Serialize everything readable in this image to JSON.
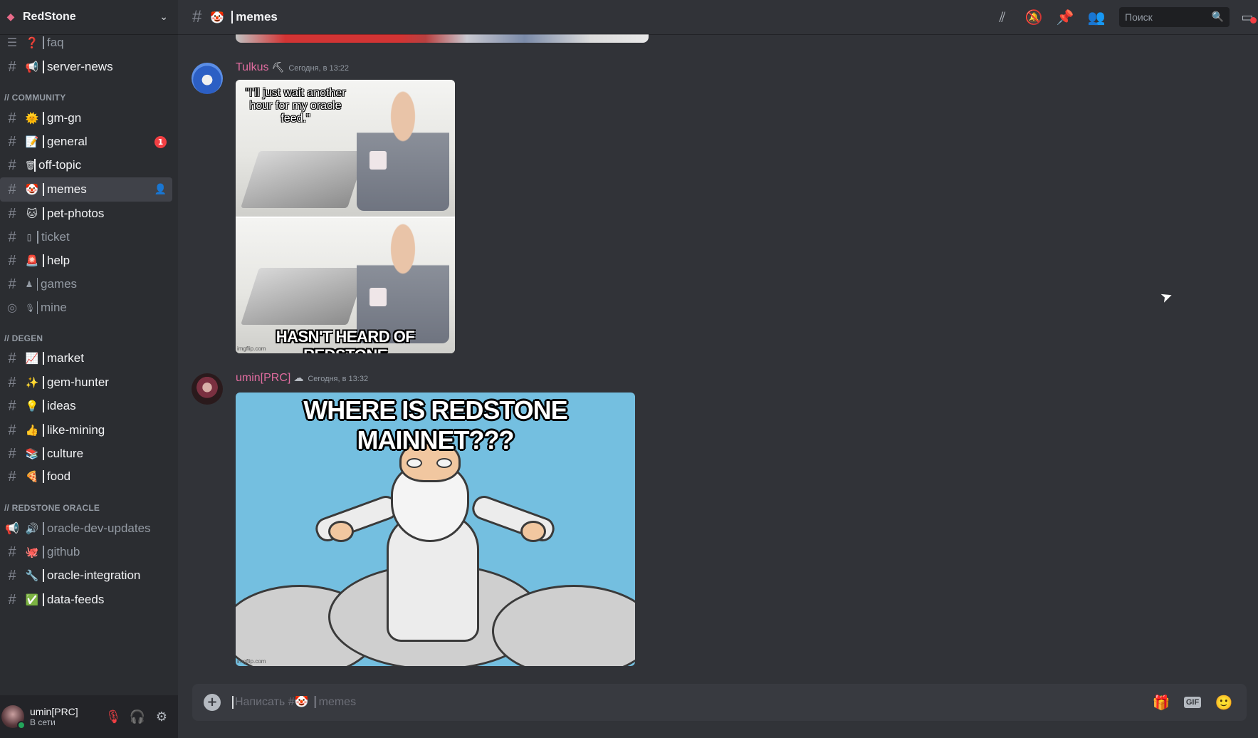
{
  "server": {
    "name": "RedStone",
    "icon": "redstone-logo-icon"
  },
  "sidebar": {
    "top_channels": [
      {
        "emoji": "❓",
        "name": "faq",
        "type": "forum",
        "state": "dim"
      },
      {
        "emoji": "📢",
        "name": "server-news",
        "type": "text",
        "state": "bright"
      }
    ],
    "categories": [
      {
        "label": "// COMMUNITY",
        "channels": [
          {
            "emoji": "🌞",
            "name": "gm-gn",
            "type": "text",
            "state": "bright"
          },
          {
            "emoji": "📝",
            "name": "general",
            "type": "text",
            "state": "bright",
            "badge": "1"
          },
          {
            "emoji": "🗑",
            "name": "off-topic",
            "type": "text",
            "state": "bright"
          },
          {
            "emoji": "🤡",
            "name": "memes",
            "type": "text",
            "state": "bright",
            "active": true
          },
          {
            "emoji": "🐱",
            "name": "pet-photos",
            "type": "text",
            "state": "bright"
          },
          {
            "emoji": "▯",
            "name": "ticket",
            "type": "text",
            "state": "dim"
          },
          {
            "emoji": "🚨",
            "name": "help",
            "type": "text",
            "state": "bright"
          },
          {
            "emoji": "♟",
            "name": "games",
            "type": "text",
            "state": "dim"
          },
          {
            "emoji": "🎙",
            "name": "mine",
            "type": "stage",
            "state": "dim"
          }
        ]
      },
      {
        "label": "// DEGEN",
        "channels": [
          {
            "emoji": "📈",
            "name": "market",
            "type": "text",
            "state": "bright"
          },
          {
            "emoji": "✨",
            "name": "gem-hunter",
            "type": "text",
            "state": "bright"
          },
          {
            "emoji": "💡",
            "name": "ideas",
            "type": "text",
            "state": "bright"
          },
          {
            "emoji": "👍",
            "name": "like-mining",
            "type": "text",
            "state": "bright"
          },
          {
            "emoji": "📚",
            "name": "culture",
            "type": "text",
            "state": "bright"
          },
          {
            "emoji": "🍕",
            "name": "food",
            "type": "text",
            "state": "bright"
          }
        ]
      },
      {
        "label": "// REDSTONE ORACLE",
        "channels": [
          {
            "emoji": "🔊",
            "name": "oracle-dev-updates",
            "type": "announcement",
            "state": "dim"
          },
          {
            "emoji": "🐙",
            "name": "github",
            "type": "text",
            "state": "dim"
          },
          {
            "emoji": "🔧",
            "name": "oracle-integration",
            "type": "text",
            "state": "bright"
          },
          {
            "emoji": "✅",
            "name": "data-feeds",
            "type": "text",
            "state": "bright"
          }
        ]
      }
    ]
  },
  "user": {
    "name": "umin[PRC]",
    "status": "В сети"
  },
  "topbar": {
    "channel_emoji": "🤡",
    "channel_name": "memes",
    "search_placeholder": "Поиск"
  },
  "messages": [
    {
      "author": "Tulkus",
      "author_emoji": "⛏",
      "timestamp": "Сегодня, в 13:22",
      "meme_top_text": "\"I'll just wait another hour for my oracle feed.\"",
      "meme_bottom_text": "HASN'T HEARD OF REDSTONE",
      "watermark": "imgflip.com"
    },
    {
      "author": "umin[PRC]",
      "author_emoji": "☁",
      "timestamp": "Сегодня, в 13:32",
      "meme_text": "WHERE IS REDSTONE MAINNET???",
      "watermark": "imgflip.com"
    }
  ],
  "composer": {
    "placeholder": "Написать #🤡 ┃memes",
    "gif_label": "GIF"
  },
  "colors": {
    "accent_author": "#e06c9f",
    "badge": "#f23f43",
    "online": "#23a55a"
  }
}
